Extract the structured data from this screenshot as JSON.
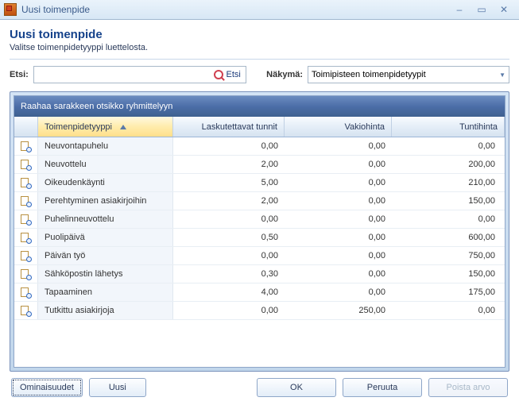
{
  "window": {
    "title": "Uusi toimenpide",
    "minimize": "–",
    "maximize": "▭",
    "close": "✕"
  },
  "header": {
    "title": "Uusi toimenpide",
    "subtitle": "Valitse toimenpidetyyppi luettelosta."
  },
  "search": {
    "label": "Etsi:",
    "value": "",
    "button": "Etsi"
  },
  "view": {
    "label": "Näkymä:",
    "selected": "Toimipisteen toimenpidetyypit"
  },
  "grid": {
    "group_hint": "Raahaa sarakkeen otsikko ryhmittelyyn",
    "columns": {
      "type": "Toimenpidetyyppi",
      "hours": "Laskutettavat tunnit",
      "fixed": "Vakiohinta",
      "rate": "Tuntihinta"
    },
    "rows": [
      {
        "type": "Neuvontapuhelu",
        "hours": "0,00",
        "fixed": "0,00",
        "rate": "0,00"
      },
      {
        "type": "Neuvottelu",
        "hours": "2,00",
        "fixed": "0,00",
        "rate": "200,00"
      },
      {
        "type": "Oikeudenkäynti",
        "hours": "5,00",
        "fixed": "0,00",
        "rate": "210,00"
      },
      {
        "type": "Perehtyminen asiakirjoihin",
        "hours": "2,00",
        "fixed": "0,00",
        "rate": "150,00"
      },
      {
        "type": "Puhelinneuvottelu",
        "hours": "0,00",
        "fixed": "0,00",
        "rate": "0,00"
      },
      {
        "type": "Puolipäivä",
        "hours": "0,50",
        "fixed": "0,00",
        "rate": "600,00"
      },
      {
        "type": "Päivän työ",
        "hours": "0,00",
        "fixed": "0,00",
        "rate": "750,00"
      },
      {
        "type": "Sähköpostin lähetys",
        "hours": "0,30",
        "fixed": "0,00",
        "rate": "150,00"
      },
      {
        "type": "Tapaaminen",
        "hours": "4,00",
        "fixed": "0,00",
        "rate": "175,00"
      },
      {
        "type": "Tutkittu asiakirjoja",
        "hours": "0,00",
        "fixed": "250,00",
        "rate": "0,00"
      }
    ]
  },
  "footer": {
    "properties": "Ominaisuudet",
    "new": "Uusi",
    "ok": "OK",
    "cancel": "Peruuta",
    "remove": "Poista arvo"
  }
}
